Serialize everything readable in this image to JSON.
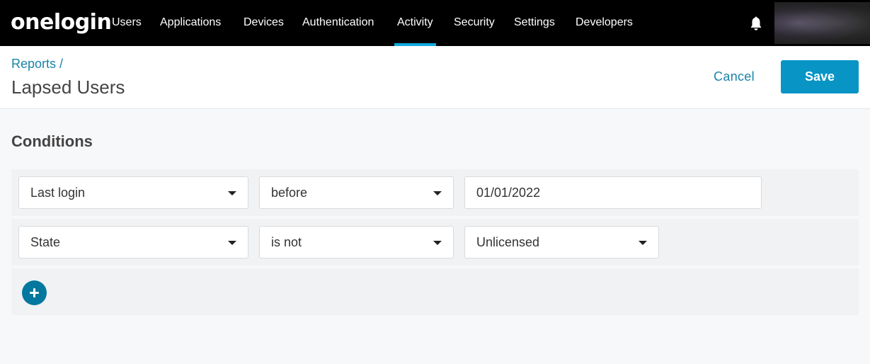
{
  "brand": {
    "logo_text": "onelogin",
    "accent": "#11a9e0",
    "primary_button": "#0895c5",
    "link": "#1a84a8"
  },
  "nav": {
    "items": [
      {
        "label": "Users",
        "active": false
      },
      {
        "label": "Applications",
        "active": false
      },
      {
        "label": "Devices",
        "active": false
      },
      {
        "label": "Authentication",
        "active": false
      },
      {
        "label": "Activity",
        "active": true
      },
      {
        "label": "Security",
        "active": false
      },
      {
        "label": "Settings",
        "active": false
      },
      {
        "label": "Developers",
        "active": false
      }
    ],
    "notifications_icon": "bell-icon",
    "user_menu": "redacted-avatar"
  },
  "header": {
    "breadcrumb": "Reports /",
    "title": "Lapsed Users",
    "cancel_label": "Cancel",
    "save_label": "Save"
  },
  "conditions": {
    "title": "Conditions",
    "rows": [
      {
        "field": "Last login",
        "operator": "before",
        "value": "01/01/2022",
        "value_type": "text"
      },
      {
        "field": "State",
        "operator": "is not",
        "value": "Unlicensed",
        "value_type": "select"
      }
    ],
    "add_icon": "plus-icon"
  }
}
